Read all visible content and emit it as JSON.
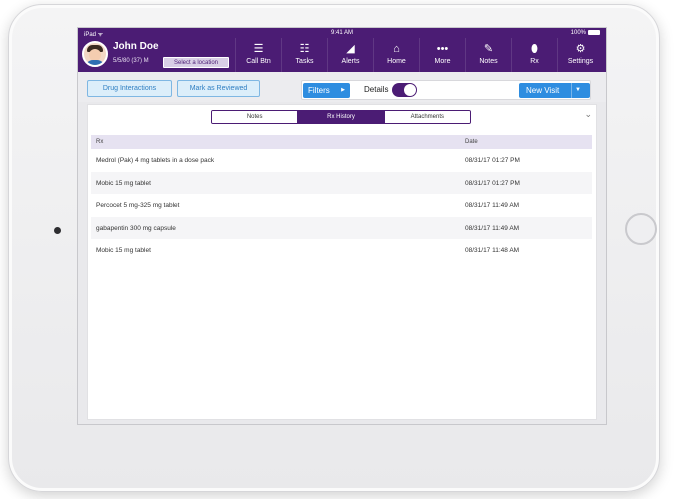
{
  "status": {
    "carrier": "iPad ᯤ",
    "time": "9:41 AM",
    "battery": "100%"
  },
  "patient": {
    "name": "John Doe",
    "dob": "5/5/80 (37) M",
    "location_button": "Select a location"
  },
  "nav": [
    {
      "label": "Call Btn",
      "icon": "call-button-icon",
      "glyph": "☰"
    },
    {
      "label": "Tasks",
      "icon": "tasks-icon",
      "glyph": "☷"
    },
    {
      "label": "Alerts",
      "icon": "alerts-icon",
      "glyph": "◢"
    },
    {
      "label": "Home",
      "icon": "home-icon",
      "glyph": "⌂"
    },
    {
      "label": "More",
      "icon": "more-icon",
      "glyph": "•••"
    },
    {
      "label": "Notes",
      "icon": "notes-icon",
      "glyph": "✎"
    },
    {
      "label": "Rx",
      "icon": "rx-icon",
      "glyph": "⬮"
    },
    {
      "label": "Settings",
      "icon": "settings-icon",
      "glyph": "⚙"
    }
  ],
  "toolbar": {
    "drug_interactions": "Drug Interactions",
    "mark_reviewed": "Mark as Reviewed",
    "filters": "Filters",
    "details": "Details",
    "details_on": true,
    "new_visit": "New Visit"
  },
  "tabs": [
    {
      "label": "Notes"
    },
    {
      "label": "Rx History",
      "active": true
    },
    {
      "label": "Attachments"
    }
  ],
  "table": {
    "columns": [
      "Rx",
      "Date"
    ],
    "rows": [
      {
        "rx": "Medrol (Pak) 4 mg tablets in a dose pack",
        "date": "08/31/17 01:27 PM"
      },
      {
        "rx": "Mobic 15 mg tablet",
        "date": "08/31/17 01:27 PM"
      },
      {
        "rx": "Percocet 5 mg-325 mg tablet",
        "date": "08/31/17 11:49 AM"
      },
      {
        "rx": "gabapentin 300 mg capsule",
        "date": "08/31/17 11:49 AM"
      },
      {
        "rx": "Mobic 15 mg tablet",
        "date": "08/31/17 11:48 AM"
      }
    ]
  },
  "colors": {
    "brand": "#4b1c74",
    "accent": "#2e8de0"
  }
}
